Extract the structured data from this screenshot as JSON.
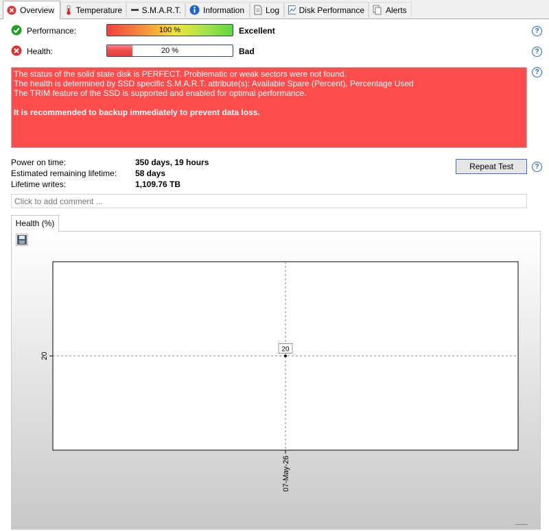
{
  "tabs": [
    {
      "label": "Overview",
      "icon": "error-icon"
    },
    {
      "label": "Temperature",
      "icon": "thermometer-icon"
    },
    {
      "label": "S.M.A.R.T.",
      "icon": "smart-icon"
    },
    {
      "label": "Information",
      "icon": "info-icon"
    },
    {
      "label": "Log",
      "icon": "document-icon"
    },
    {
      "label": "Disk Performance",
      "icon": "chart-icon"
    },
    {
      "label": "Alerts",
      "icon": "alerts-icon"
    }
  ],
  "performance": {
    "label": "Performance:",
    "percent_text": "100 %",
    "value": 100,
    "rating": "Excellent"
  },
  "health": {
    "label": "Health:",
    "percent_text": "20 %",
    "value": 20,
    "rating": "Bad"
  },
  "status": {
    "lines": [
      "The status of the solid state disk is PERFECT. Problematic or weak sectors were not found.",
      "The health is determined by SSD specific S.M.A.R.T. attribute(s):  Available Spare (Percent), Percentage Used",
      "The TRIM feature of the SSD is supported and enabled for optimal performance."
    ],
    "warning": "It is recommended to backup immediately to prevent data loss.",
    "color": "#ff4d4d"
  },
  "stats": [
    {
      "label": "Power on time:",
      "value": "350 days, 19 hours"
    },
    {
      "label": "Estimated remaining lifetime:",
      "value": "58 days"
    },
    {
      "label": "Lifetime writes:",
      "value": "1,109.76 TB"
    }
  ],
  "repeat_button": "Repeat Test",
  "comment": {
    "placeholder": "Click to add comment ..."
  },
  "chart_tab": "Health (%)",
  "colors": {
    "ok": "#22a022",
    "error": "#e03030",
    "help": "#1a66c9",
    "status_bg": "#ff4d4d"
  },
  "chart_data": {
    "type": "line",
    "x": [
      "07-May-26"
    ],
    "series": [
      {
        "values": [
          20
        ]
      }
    ],
    "ytick": "20",
    "xtick": "07-May-26",
    "data_label": "20",
    "grid": true
  }
}
